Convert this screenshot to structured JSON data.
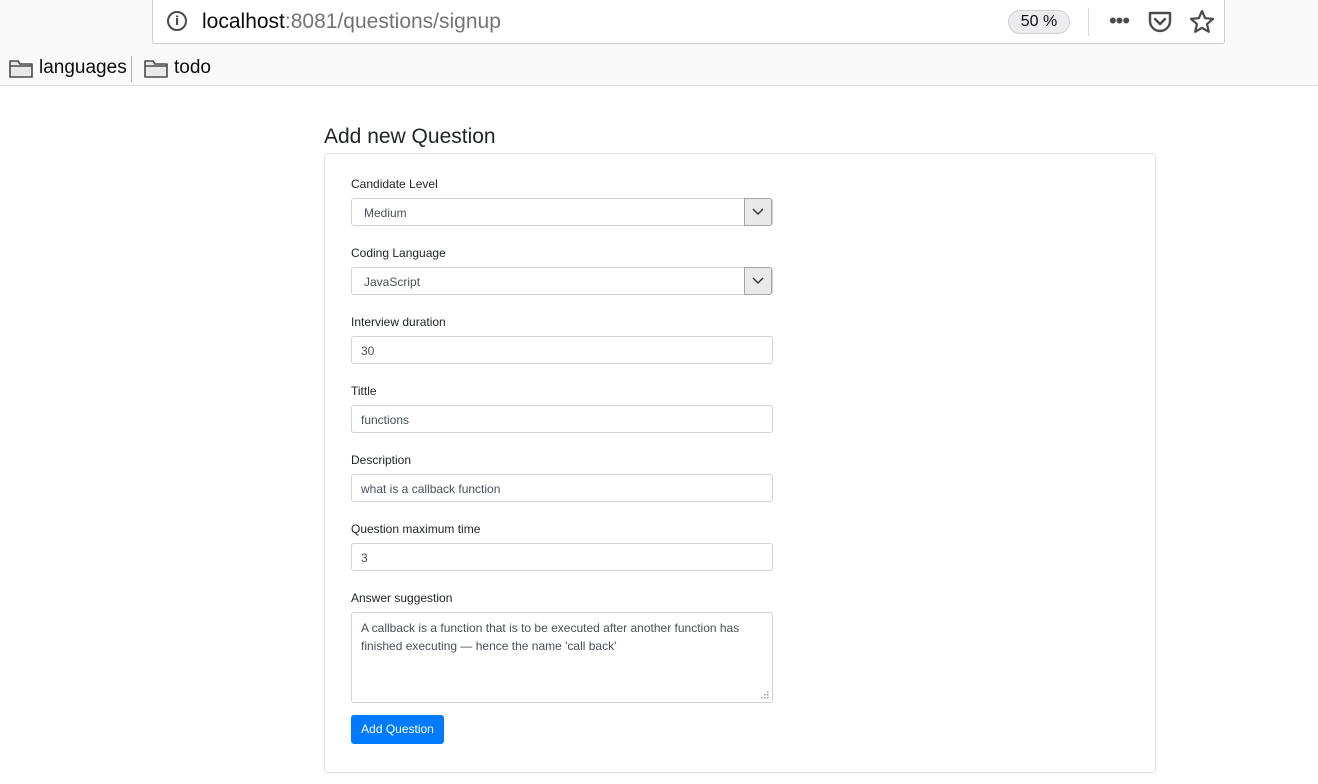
{
  "browser": {
    "url_host": "localhost",
    "url_path": ":8081/questions/signup",
    "zoom": "50 %",
    "bookmarks": [
      {
        "label": "languages"
      },
      {
        "label": "todo"
      }
    ]
  },
  "page": {
    "title": "Add new Question"
  },
  "form": {
    "candidate_level": {
      "label": "Candidate Level",
      "value": "Medium"
    },
    "coding_language": {
      "label": "Coding Language",
      "value": "JavaScript"
    },
    "interview_duration": {
      "label": "Interview duration",
      "value": "30"
    },
    "title": {
      "label": "Tittle",
      "value": "functions"
    },
    "description": {
      "label": "Description",
      "value": "what is a callback function"
    },
    "question_max_time": {
      "label": "Question maximum time",
      "value": "3"
    },
    "answer_suggestion": {
      "label": "Answer suggestion",
      "value": "A callback is a function that is to be executed after another function has finished executing — hence the name 'call back'"
    },
    "submit_label": "Add Question"
  },
  "colors": {
    "primary": "#007bff",
    "border": "#ced4da"
  }
}
